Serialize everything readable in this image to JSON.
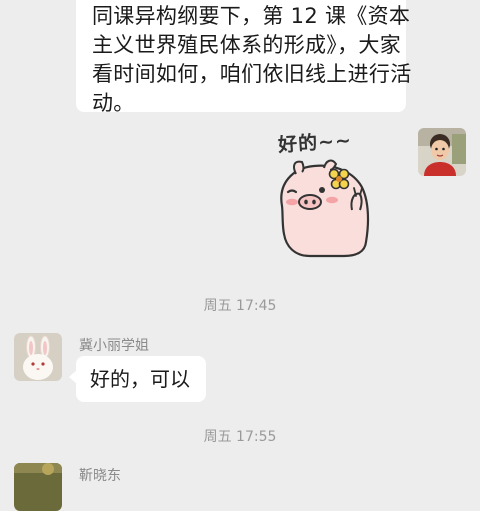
{
  "chat": {
    "prev_message_lines": [
      "同课异构纲要下，第 12 课《资本",
      "主义世界殖民体系的形成》，大家",
      "看时间如何，咱们依旧线上进行活",
      "动。"
    ],
    "sticker": {
      "caption": "好的~~",
      "icon": "pig-sticker-icon"
    },
    "timestamp_1": "周五 17:45",
    "message_2": {
      "sender": "冀小丽学姐",
      "text": "好的，可以",
      "avatar_icon": "rabbit-avatar"
    },
    "timestamp_2": "周五 17:55",
    "message_3": {
      "sender": "靳晓东",
      "avatar_icon": "landscape-avatar"
    }
  },
  "colors": {
    "background": "#ededed",
    "bubble": "#ffffff",
    "timestamp_text": "#9a9a9a",
    "sender_text": "#8a8a8a"
  }
}
